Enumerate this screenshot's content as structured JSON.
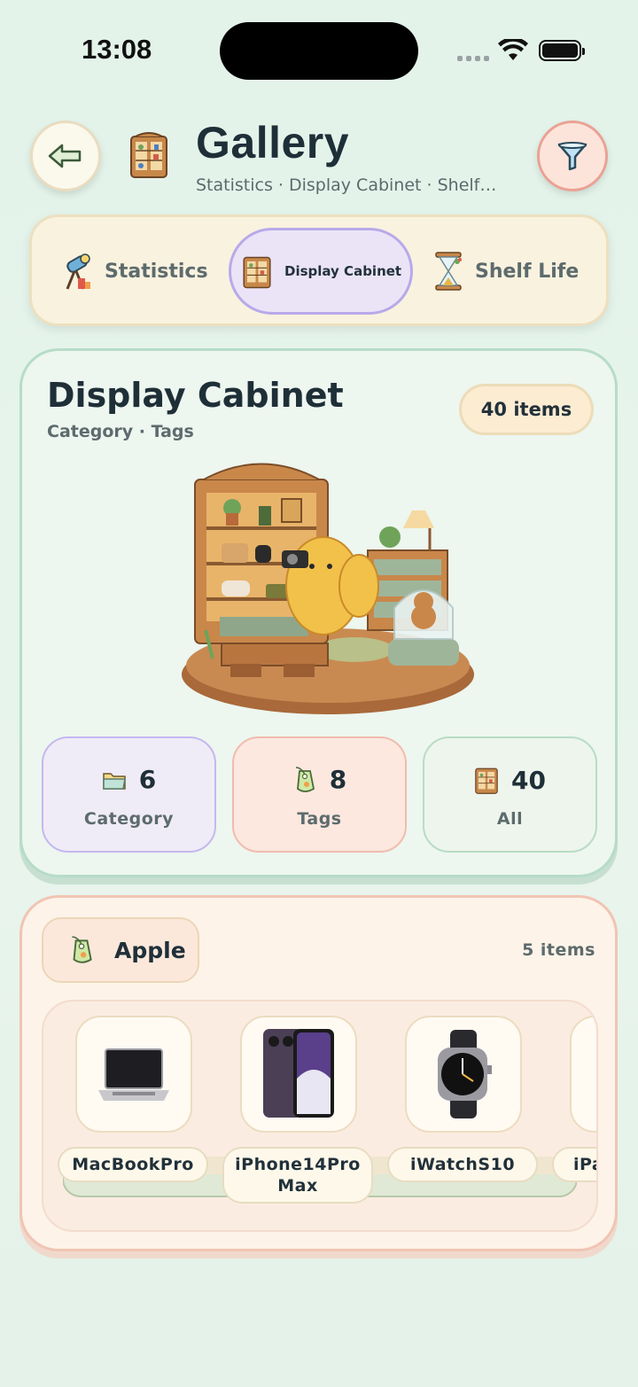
{
  "status_bar": {
    "time": "13:08"
  },
  "header": {
    "title": "Gallery",
    "subtitle": "Statistics · Display Cabinet · Shelf…"
  },
  "tabs": [
    {
      "label": "Statistics",
      "icon": "telescope-icon",
      "selected": false
    },
    {
      "label": "Display Cabinet",
      "icon": "cabinet-icon",
      "selected": true
    },
    {
      "label": "Shelf Life",
      "icon": "hourglass-icon",
      "selected": false
    }
  ],
  "cabinet": {
    "title": "Display Cabinet",
    "subtitle": "Category · Tags",
    "count": "40 items",
    "stats": [
      {
        "value": "6",
        "label": "Category",
        "icon": "folder-icon"
      },
      {
        "value": "8",
        "label": "Tags",
        "icon": "tag-icon"
      },
      {
        "value": "40",
        "label": "All",
        "icon": "cabinet-icon"
      }
    ]
  },
  "brand_section": {
    "brand": "Apple",
    "count": "5 items",
    "items": [
      {
        "name": "MacBookPro",
        "icon": "laptop-icon"
      },
      {
        "name": "iPhone14Pro Max",
        "icon": "phone-icon"
      },
      {
        "name": "iWatchS10",
        "icon": "watch-icon"
      },
      {
        "name": "iPa",
        "icon": "tablet-icon"
      }
    ]
  },
  "colors": {
    "background": "#e3f3ea",
    "accent_purple": "#b8a9ea",
    "accent_coral": "#e9a294",
    "accent_green": "#b6dcc8"
  }
}
